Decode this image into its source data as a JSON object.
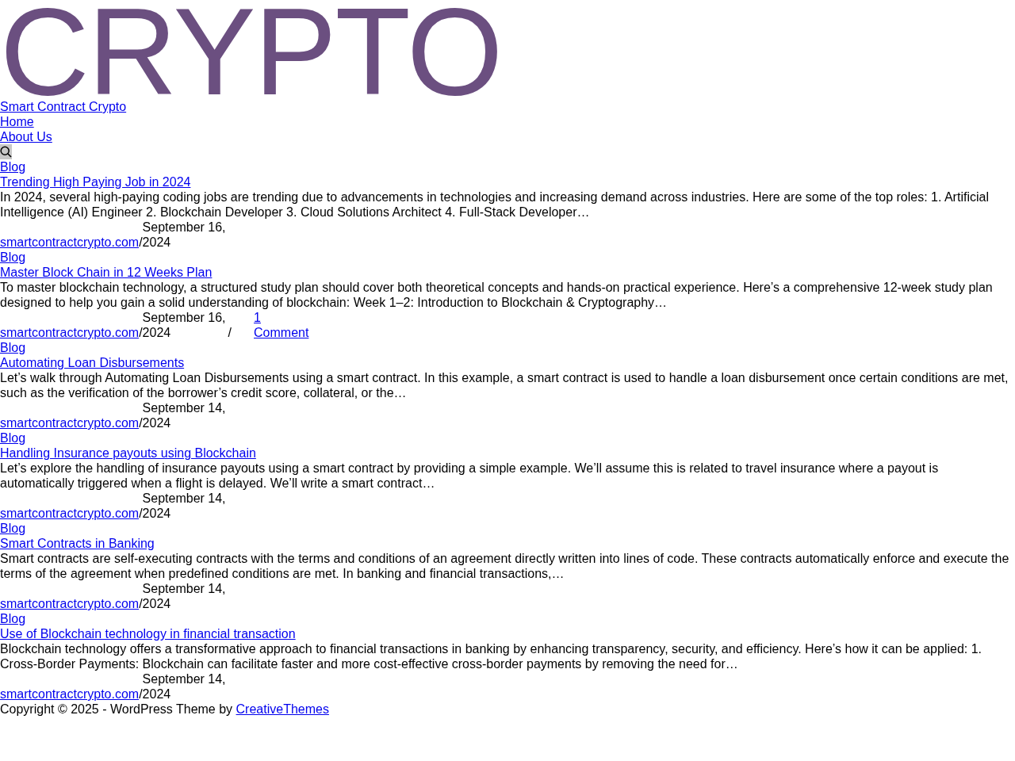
{
  "logo": "CRYPTO",
  "site_title": "Smart Contract Crypto",
  "nav": [
    {
      "label": "Home"
    },
    {
      "label": "About Us"
    }
  ],
  "posts": [
    {
      "category": "Blog",
      "title": "Trending High Paying Job in 2024",
      "excerpt": "In 2024, several high-paying coding jobs are trending due to advancements in technologies and increasing demand across industries. Here are some of the top roles: 1. Artificial Intelligence (AI) Engineer 2. Blockchain Developer 3. Cloud Solutions Architect 4. Full-Stack Developer…",
      "author": "smartcontractcrypto.com",
      "author_separator": "/",
      "date": "September 16, 2024"
    },
    {
      "category": "Blog",
      "title": "Master Block Chain in 12 Weeks Plan",
      "excerpt": "To master blockchain technology, a structured study plan should cover both theoretical concepts and hands-on practical experience. Here’s a comprehensive 12-week study plan designed to help you gain a solid understanding of blockchain: Week 1–2: Introduction to Blockchain & Cryptography…",
      "author": "smartcontractcrypto.com",
      "author_separator": "/",
      "date": "September 16, 2024",
      "date_separator": "/",
      "comments": "1 Comment"
    },
    {
      "category": "Blog",
      "title": "Automating Loan Disbursements",
      "excerpt": "Let’s walk through Automating Loan Disbursements using a smart contract. In this example, a smart contract is used to handle a loan disbursement once certain conditions are met, such as the verification of the borrower’s credit score, collateral, or the…",
      "author": "smartcontractcrypto.com",
      "author_separator": "/",
      "date": "September 14, 2024"
    },
    {
      "category": "Blog",
      "title": "Handling Insurance payouts using Blockchain",
      "excerpt": "Let’s explore the handling of insurance payouts using a smart contract by providing a simple example. We’ll assume this is related to travel insurance where a payout is automatically triggered when a flight is delayed. We’ll write a smart contract…",
      "author": "smartcontractcrypto.com",
      "author_separator": "/",
      "date": "September 14, 2024"
    },
    {
      "category": "Blog",
      "title": "Smart Contracts in Banking",
      "excerpt": "Smart contracts are self-executing contracts with the terms and conditions of an agreement directly written into lines of code. These contracts automatically enforce and execute the terms of the agreement when predefined conditions are met. In banking and financial transactions,…",
      "author": "smartcontractcrypto.com",
      "author_separator": "/",
      "date": "September 14, 2024"
    },
    {
      "category": "Blog",
      "title": "Use of Blockchain technology in financial transaction",
      "excerpt": "Blockchain technology offers a transformative approach to financial transactions in banking by enhancing transparency, security, and efficiency. Here’s how it can be applied: 1. Cross-Border Payments: Blockchain can facilitate faster and more cost-effective cross-border payments by removing the need for…",
      "author": "smartcontractcrypto.com",
      "author_separator": "/",
      "date": "September 14, 2024"
    }
  ],
  "footer": {
    "text": "Copyright © 2025 - WordPress Theme by ",
    "link": "CreativeThemes"
  }
}
